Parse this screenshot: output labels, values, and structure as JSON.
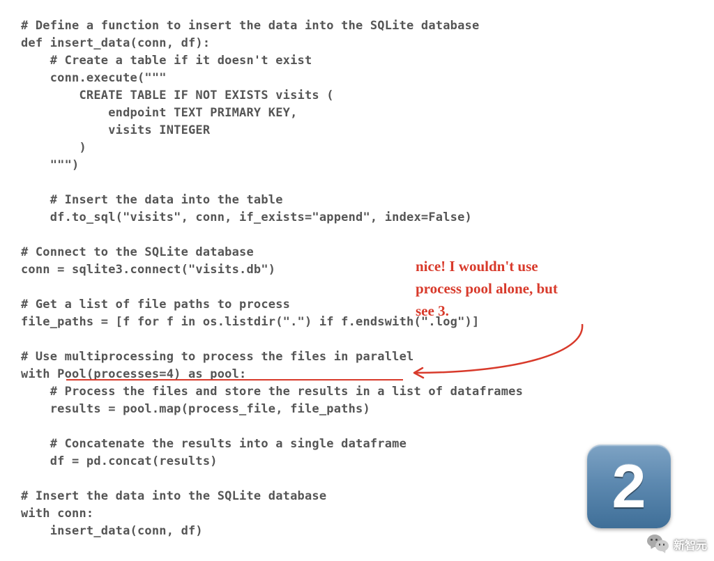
{
  "code": {
    "lines": [
      "# Define a function to insert the data into the SQLite database",
      "def insert_data(conn, df):",
      "    # Create a table if it doesn't exist",
      "    conn.execute(\"\"\"",
      "        CREATE TABLE IF NOT EXISTS visits (",
      "            endpoint TEXT PRIMARY KEY,",
      "            visits INTEGER",
      "        )",
      "    \"\"\")",
      "",
      "    # Insert the data into the table",
      "    df.to_sql(\"visits\", conn, if_exists=\"append\", index=False)",
      "",
      "# Connect to the SQLite database",
      "conn = sqlite3.connect(\"visits.db\")",
      "",
      "# Get a list of file paths to process",
      "file_paths = [f for f in os.listdir(\".\") if f.endswith(\".log\")]",
      "",
      "# Use multiprocessing to process the files in parallel",
      "with Pool(processes=4) as pool:",
      "    # Process the files and store the results in a list of dataframes",
      "    results = pool.map(process_file, file_paths)",
      "",
      "    # Concatenate the results into a single dataframe",
      "    df = pd.concat(results)",
      "",
      "# Insert the data into the SQLite database",
      "with conn:",
      "    insert_data(conn, df)"
    ]
  },
  "annotation": {
    "line1": "nice! I wouldn't use",
    "line2": "process pool alone, but",
    "line3": "see 3."
  },
  "badge": {
    "number": "2"
  },
  "watermark": {
    "text": "新智元"
  },
  "colors": {
    "annotation_red": "#d83a2b",
    "code_gray": "#555555",
    "badge_gradient_top": "#7ea3c4",
    "badge_gradient_bottom": "#3f6f98"
  }
}
